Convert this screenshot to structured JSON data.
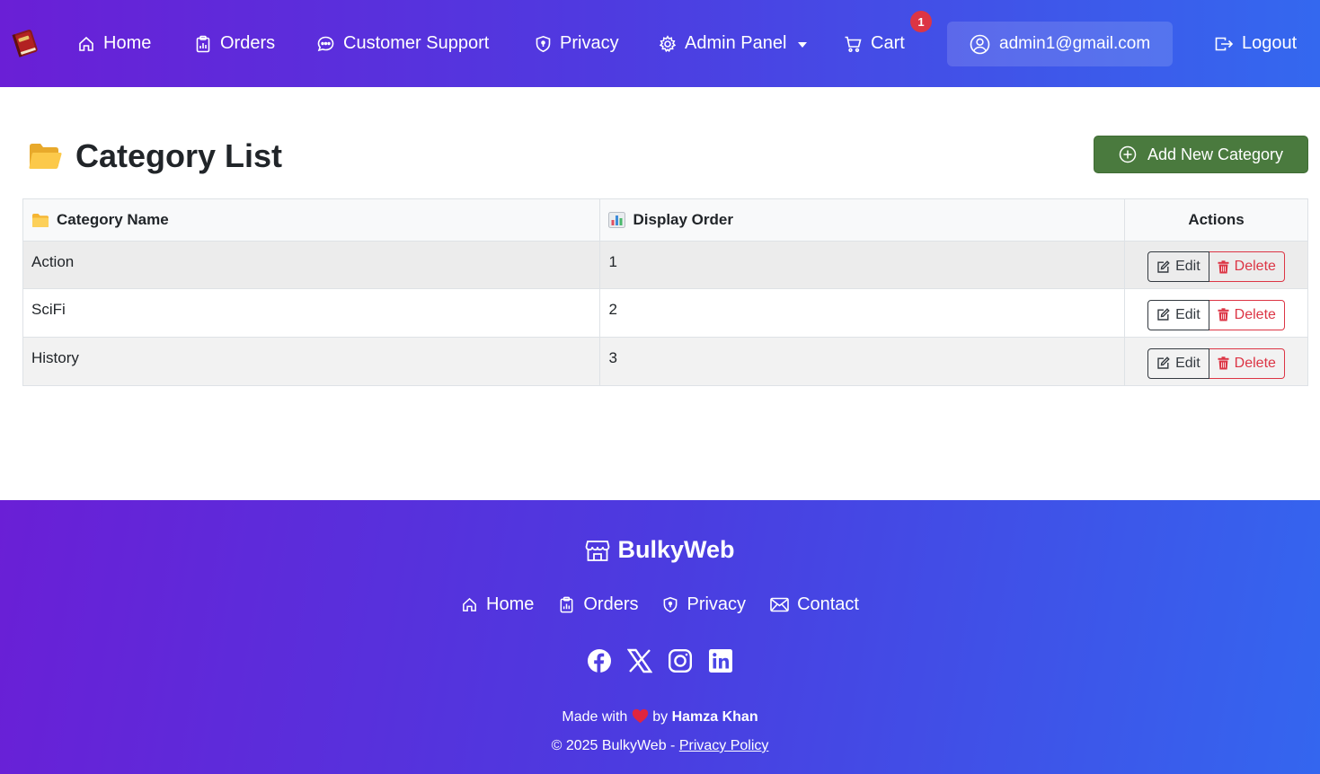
{
  "nav": {
    "items": [
      {
        "label": "Home",
        "icon": "house-icon"
      },
      {
        "label": "Orders",
        "icon": "clipboard-data-icon"
      },
      {
        "label": "Customer Support",
        "icon": "chat-dots-icon"
      },
      {
        "label": "Privacy",
        "icon": "shield-icon"
      },
      {
        "label": "Admin Panel",
        "icon": "gear-icon"
      },
      {
        "label": "Cart",
        "icon": "cart-icon"
      }
    ],
    "cart_count": "1",
    "user_email": "admin1@gmail.com",
    "logout_label": "Logout"
  },
  "header": {
    "title": "Category List",
    "add_button_label": "Add New Category"
  },
  "table": {
    "columns": [
      "Category Name",
      "Display Order",
      "Actions"
    ],
    "rows": [
      {
        "name": "Action",
        "order": "1"
      },
      {
        "name": "SciFi",
        "order": "2"
      },
      {
        "name": "History",
        "order": "3"
      }
    ],
    "edit_label": "Edit",
    "delete_label": "Delete"
  },
  "footer": {
    "brand": "BulkyWeb",
    "links": [
      "Home",
      "Orders",
      "Privacy",
      "Contact"
    ],
    "made_with": "Made with",
    "by": "by",
    "author": "Hamza Khan",
    "copyright": "© 2025 BulkyWeb -",
    "privacy_link": "Privacy Policy"
  },
  "colors": {
    "gradient_start": "#6a1fd6",
    "gradient_end": "#3468ef",
    "add_button": "#4a7a3e",
    "delete": "#dc3545",
    "badge": "#dc3545"
  }
}
